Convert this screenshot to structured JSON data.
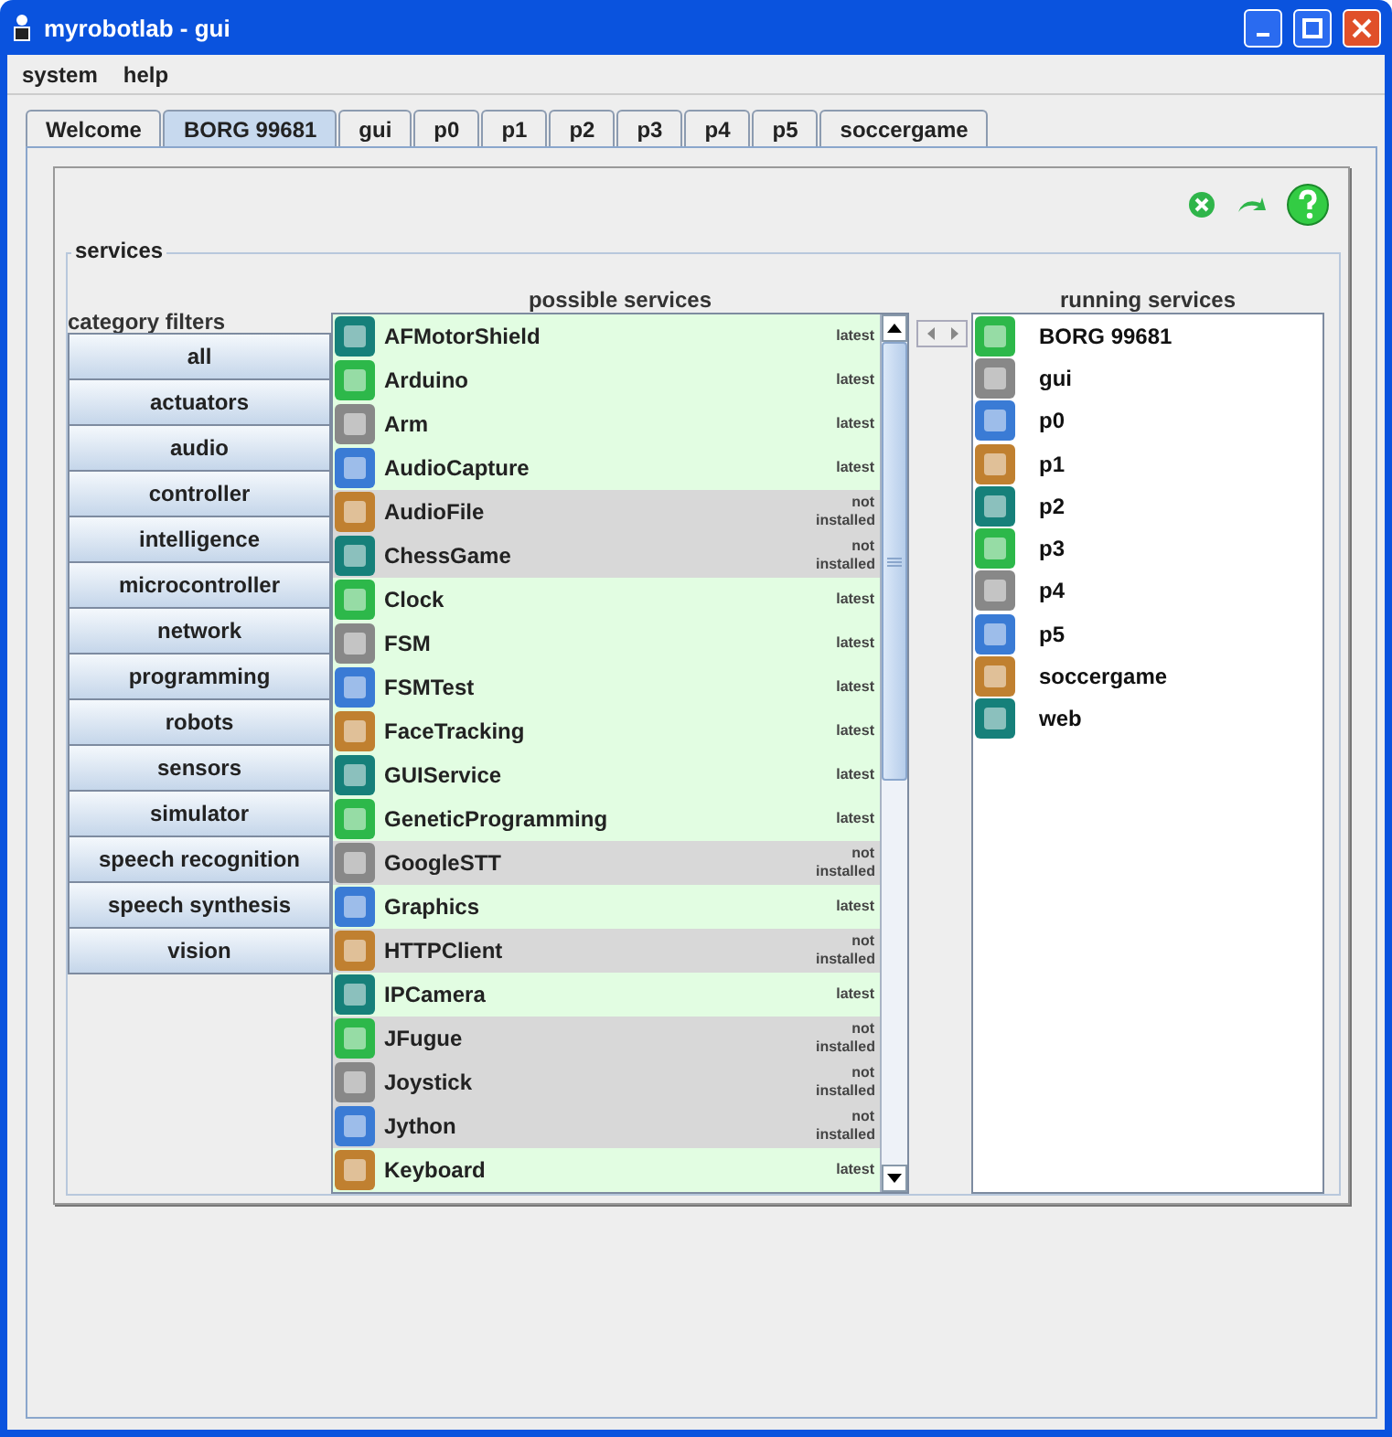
{
  "window": {
    "title": "myrobotlab - gui"
  },
  "menu": [
    "system",
    "help"
  ],
  "tabs": [
    {
      "label": "Welcome",
      "selected": false
    },
    {
      "label": "BORG 99681",
      "selected": true
    },
    {
      "label": "gui",
      "selected": false
    },
    {
      "label": "p0",
      "selected": false
    },
    {
      "label": "p1",
      "selected": false
    },
    {
      "label": "p2",
      "selected": false
    },
    {
      "label": "p3",
      "selected": false
    },
    {
      "label": "p4",
      "selected": false
    },
    {
      "label": "p5",
      "selected": false
    },
    {
      "label": "soccergame",
      "selected": false
    }
  ],
  "services_title": "services",
  "category_filters": {
    "title": "category filters",
    "items": [
      "all",
      "actuators",
      "audio",
      "controller",
      "intelligence",
      "microcontroller",
      "network",
      "programming",
      "robots",
      "sensors",
      "simulator",
      "speech recognition",
      "speech synthesis",
      "vision"
    ]
  },
  "possible_services": {
    "title": "possible services",
    "rows": [
      {
        "name": "AFMotorShield",
        "status": "latest",
        "installed": true
      },
      {
        "name": "Arduino",
        "status": "latest",
        "installed": true
      },
      {
        "name": "Arm",
        "status": "latest",
        "installed": true
      },
      {
        "name": "AudioCapture",
        "status": "latest",
        "installed": true
      },
      {
        "name": "AudioFile",
        "status": "not installed",
        "installed": false
      },
      {
        "name": "ChessGame",
        "status": "not installed",
        "installed": false
      },
      {
        "name": "Clock",
        "status": "latest",
        "installed": true
      },
      {
        "name": "FSM",
        "status": "latest",
        "installed": true
      },
      {
        "name": "FSMTest",
        "status": "latest",
        "installed": true
      },
      {
        "name": "FaceTracking",
        "status": "latest",
        "installed": true
      },
      {
        "name": "GUIService",
        "status": "latest",
        "installed": true
      },
      {
        "name": "GeneticProgramming",
        "status": "latest",
        "installed": true
      },
      {
        "name": "GoogleSTT",
        "status": "not installed",
        "installed": false
      },
      {
        "name": "Graphics",
        "status": "latest",
        "installed": true
      },
      {
        "name": "HTTPClient",
        "status": "not installed",
        "installed": false
      },
      {
        "name": "IPCamera",
        "status": "latest",
        "installed": true
      },
      {
        "name": "JFugue",
        "status": "not installed",
        "installed": false
      },
      {
        "name": "Joystick",
        "status": "not installed",
        "installed": false
      },
      {
        "name": "Jython",
        "status": "not installed",
        "installed": false
      },
      {
        "name": "Keyboard",
        "status": "latest",
        "installed": true
      }
    ]
  },
  "running_services": {
    "title": "running services",
    "rows": [
      "BORG 99681",
      "gui",
      "p0",
      "p1",
      "p2",
      "p3",
      "p4",
      "p5",
      "soccergame",
      "web"
    ]
  }
}
